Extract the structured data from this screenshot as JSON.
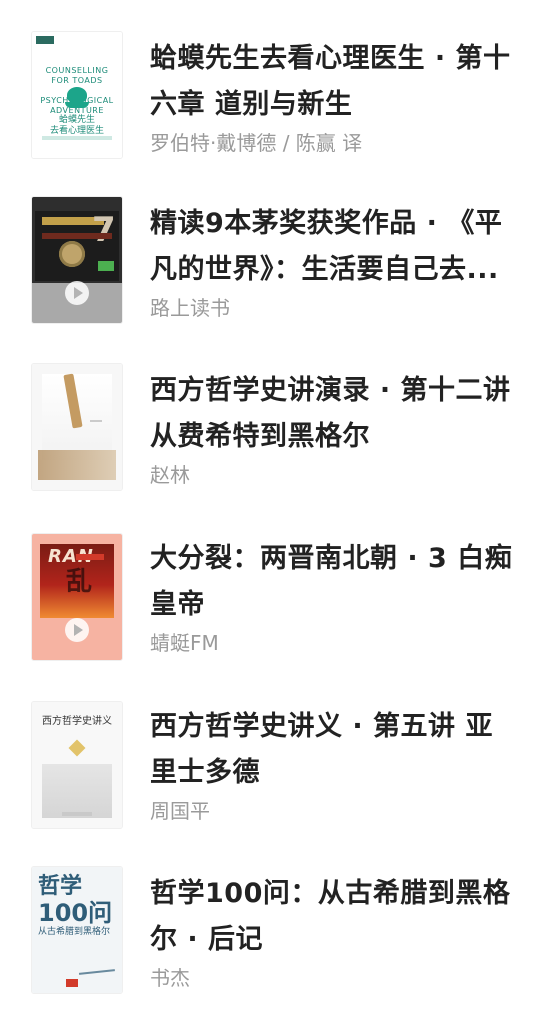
{
  "items": [
    {
      "title": "蛤蟆先生去看心理医生 · 第十六章 道别与新生",
      "author": "罗伯特·戴博德 / 陈赢 译",
      "cover": {
        "style": "frog-book",
        "text": "COUNSELLING FOR TOADS\nA PSYCHOLOGICAL ADVENTURE\n蛤蟆先生\n去看心理医生"
      },
      "has_play": false
    },
    {
      "title": "精读9本茅奖获奖作品 · 《平凡的世界》：生活要自己去...",
      "author": "路上读书",
      "cover": {
        "style": "mao-prize-audio",
        "text": "精读 茅盾文学奖 长篇小说 7本"
      },
      "has_play": true
    },
    {
      "title": "西方哲学史讲演录 · 第十二讲 从费希特到黑格尔",
      "author": "赵林",
      "cover": {
        "style": "western-philosophy-lectures",
        "text": "西方哲学史讲演录"
      },
      "has_play": false
    },
    {
      "title": "大分裂：两晋南北朝 · 3 白痴皇帝",
      "author": "蜻蜓FM",
      "cover": {
        "style": "ran-poster",
        "text": "RAN 乱"
      },
      "has_play": true
    },
    {
      "title": "西方哲学史讲义 · 第五讲 亚里士多德",
      "author": "周国平",
      "cover": {
        "style": "philosophy-lectures",
        "text": "西方哲学史讲义"
      },
      "has_play": false
    },
    {
      "title": "哲学100问：从古希腊到黑格尔 · 后记",
      "author": "书杰",
      "cover": {
        "style": "philosophy-100-questions",
        "text": "哲学 100问"
      },
      "has_play": false
    }
  ]
}
